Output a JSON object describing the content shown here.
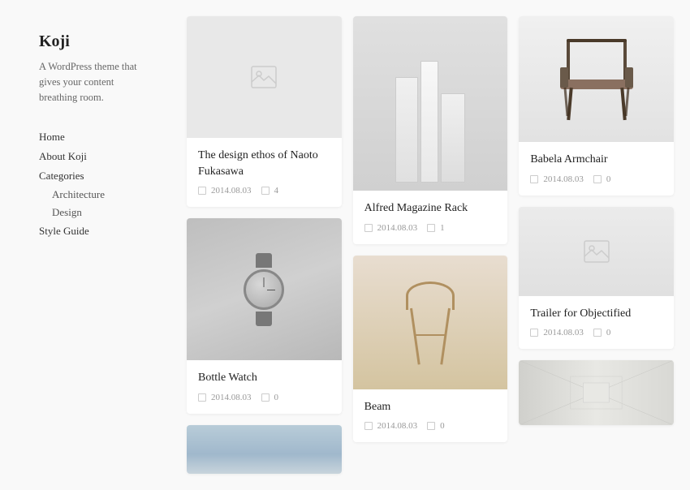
{
  "sidebar": {
    "title": "Koji",
    "description": "A WordPress theme that gives your content breathing room.",
    "nav": [
      {
        "label": "Home",
        "type": "link"
      },
      {
        "label": "About Koji",
        "type": "link"
      },
      {
        "label": "Categories",
        "type": "heading"
      },
      {
        "label": "Architecture",
        "type": "sub"
      },
      {
        "label": "Design",
        "type": "sub"
      },
      {
        "label": "Style Guide",
        "type": "link"
      }
    ]
  },
  "cards": [
    {
      "id": "card-naoto",
      "title": "The design ethos of Naoto Fukasawa",
      "date": "2014.08.03",
      "comments": "4",
      "image_type": "placeholder",
      "col": 0,
      "order": 0
    },
    {
      "id": "card-watch",
      "title": "Bottle Watch",
      "date": "2014.08.03",
      "comments": "0",
      "image_type": "watch",
      "col": 0,
      "order": 1
    },
    {
      "id": "card-building",
      "title": "",
      "date": "",
      "comments": "",
      "image_type": "building",
      "col": 0,
      "order": 2
    },
    {
      "id": "card-magazine",
      "title": "Alfred Magazine Rack",
      "date": "2014.08.03",
      "comments": "1",
      "image_type": "magazine",
      "col": 1,
      "order": 0
    },
    {
      "id": "card-beam",
      "title": "Beam",
      "date": "2014.08.03",
      "comments": "0",
      "image_type": "beam",
      "col": 1,
      "order": 1
    },
    {
      "id": "card-chair",
      "title": "Babela Armchair",
      "date": "2014.08.03",
      "comments": "0",
      "image_type": "chair",
      "col": 2,
      "order": 0
    },
    {
      "id": "card-objectified",
      "title": "Trailer for Objectified",
      "date": "2014.08.03",
      "comments": "0",
      "image_type": "placeholder2",
      "col": 2,
      "order": 1
    },
    {
      "id": "card-corridor",
      "title": "",
      "date": "",
      "comments": "",
      "image_type": "corridor",
      "col": 2,
      "order": 2
    }
  ],
  "icons": {
    "calendar": "📅",
    "comment": "💬",
    "image_placeholder": "🖼"
  }
}
